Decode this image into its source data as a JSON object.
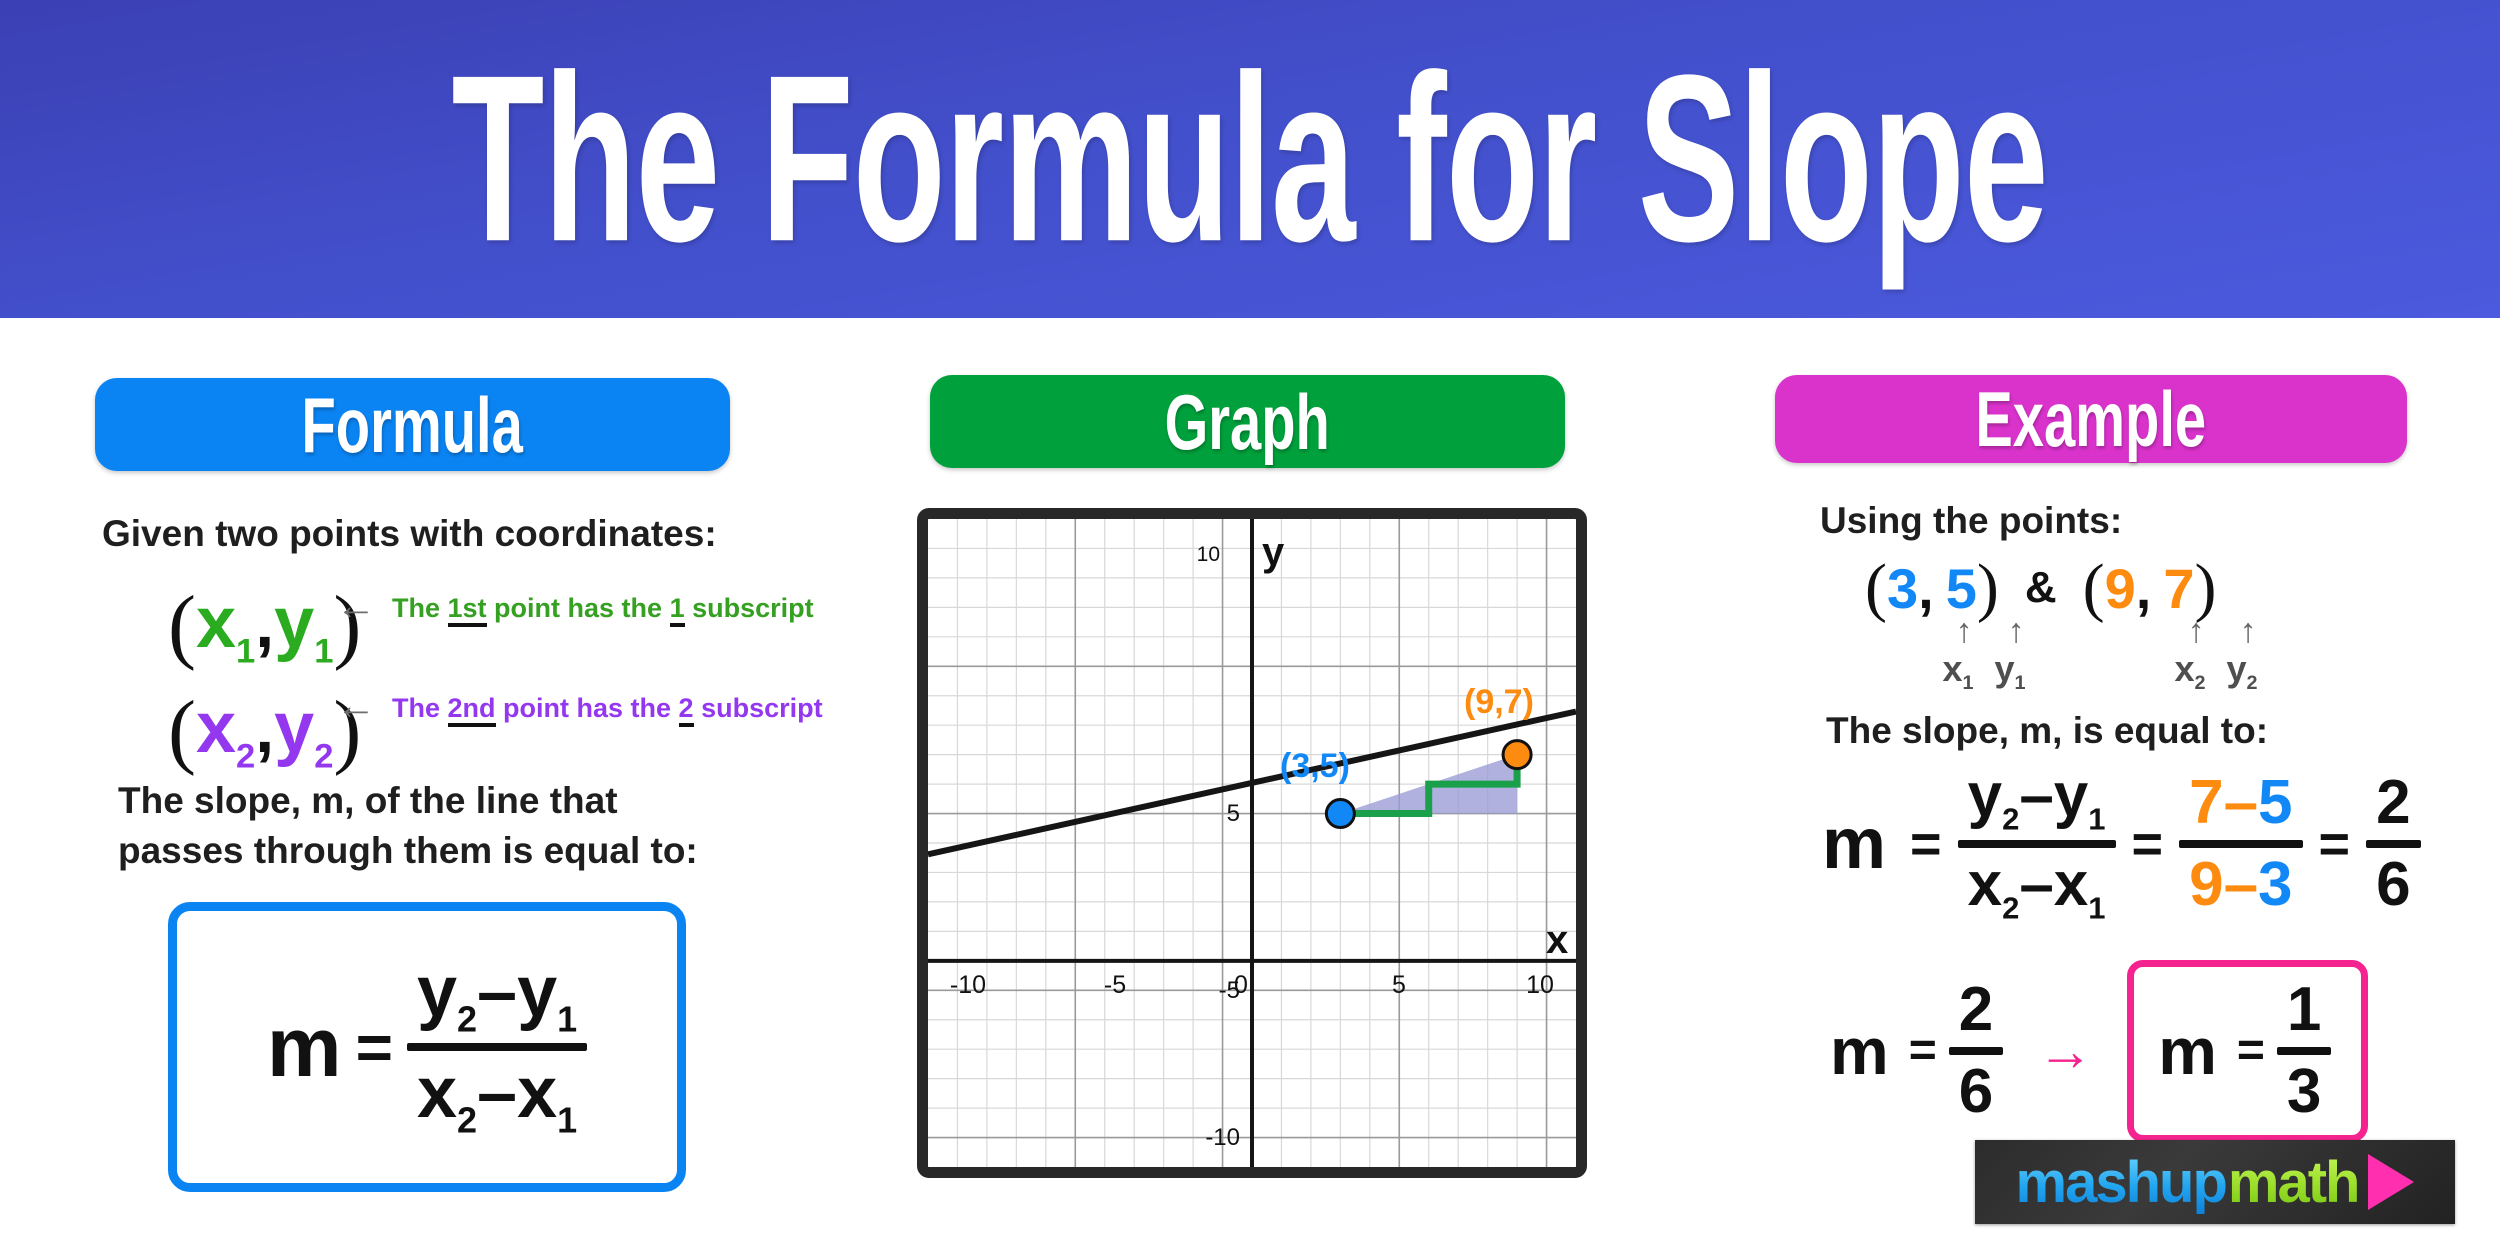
{
  "header": {
    "title": "The Formula for Slope",
    "bg_color": "#4350cc"
  },
  "sections": {
    "formula": {
      "label": "Formula",
      "color": "#0b84f3"
    },
    "graph": {
      "label": "Graph",
      "color": "#00a13c"
    },
    "example": {
      "label": "Example",
      "color": "#da33cc"
    }
  },
  "formula_panel": {
    "given_label": "Given two points with coordinates:",
    "point1": {
      "open": "(",
      "x": "x",
      "xsub": "1",
      "comma": ",",
      "y": "y",
      "ysub": "1",
      "close": ")",
      "color": "#2bab1f"
    },
    "point2": {
      "open": "(",
      "x": "x",
      "xsub": "2",
      "comma": ",",
      "y": "y",
      "ysub": "2",
      "close": ")",
      "color": "#9438f0"
    },
    "note1": {
      "arrow": "←",
      "pre": "The ",
      "u1": "1st",
      "mid": " point has the ",
      "u2": "1",
      "post": " subscript",
      "color": "#35a021"
    },
    "note2": {
      "arrow": "←",
      "pre": "The ",
      "u1": "2nd",
      "mid": " point has the ",
      "u2": "2",
      "post": " subscript",
      "color": "#9438f0"
    },
    "slope_desc_line1": "The slope, m, of the line that",
    "slope_desc_line2": "passes through them is equal to:",
    "boxed_formula": {
      "lhs": "m",
      "equals": "=",
      "numerator": {
        "a": "y",
        "asub": "2",
        "op": "–",
        "b": "y",
        "bsub": "1"
      },
      "denominator": {
        "a": "x",
        "asub": "2",
        "op": "–",
        "b": "x",
        "bsub": "1"
      },
      "border_color": "#0b84f3"
    }
  },
  "graph_panel": {
    "x_axis_label": "x",
    "y_axis_label": "y",
    "point_a_label": "(3,5)",
    "point_b_label": "(9,7)",
    "point_a_color": "#1288f7",
    "point_b_color": "#fd8b10",
    "step_color": "#1aa04a",
    "triangle_fill": "#9b9bd6",
    "frame_color": "#282828"
  },
  "example_panel": {
    "using_points_label": "Using the points:",
    "point1": {
      "open": "(",
      "x": "3",
      "comma": ",",
      "y": "5",
      "close": ")",
      "color": "#1288f7"
    },
    "point2": {
      "open": "(",
      "x": "9",
      "comma": ",",
      "y": "7",
      "close": ")",
      "color": "#fd8b10"
    },
    "ampersand": "&",
    "arrow_up": "↑",
    "labels1": {
      "x": "x",
      "xsub": "1",
      "y": "y",
      "ysub": "1"
    },
    "labels2": {
      "x": "x",
      "xsub": "2",
      "y": "y",
      "ysub": "2"
    },
    "slope_equal_label": "The slope, m, is equal to:",
    "main_equation": {
      "lhs": "m",
      "equals1": "=",
      "frac1": {
        "numerator": {
          "a": "y",
          "asub": "2",
          "op": "–",
          "b": "y",
          "bsub": "1"
        },
        "denominator": {
          "a": "x",
          "asub": "2",
          "op": "–",
          "b": "x",
          "bsub": "1"
        }
      },
      "equals2": "=",
      "frac2": {
        "num_a": "7",
        "num_op": "–",
        "num_b": "5",
        "den_a": "9",
        "den_op": "–",
        "den_b": "3"
      },
      "equals3": "=",
      "frac3": {
        "num": "2",
        "den": "6"
      }
    },
    "final_line": {
      "lhs": "m",
      "equals": "=",
      "frac": {
        "num": "2",
        "den": "6"
      },
      "arrow": "→",
      "answer": {
        "lhs": "m",
        "equals": "=",
        "num": "1",
        "den": "3"
      },
      "answer_border_color": "#f5238f",
      "arrow_color": "#f5238f"
    }
  },
  "logo": {
    "part1": "mashup",
    "part2": "math",
    "play_icon": "play-triangle",
    "part1_color": "#22a6f0",
    "part2_color": "#9ade2a",
    "play_color": "#ff2fb0"
  },
  "chart_data": {
    "type": "line",
    "title": "Graph",
    "xlabel": "x",
    "ylabel": "y",
    "xlim": [
      -11,
      11
    ],
    "ylim": [
      -11,
      11
    ],
    "xticks": [
      -10,
      -5,
      0,
      5,
      10
    ],
    "yticks": [
      -10,
      -5,
      5,
      10
    ],
    "grid": true,
    "grid_minor_step": 1,
    "grid_major_step": 5,
    "line": {
      "slope": 0.3333333,
      "intercept": 4,
      "equation": "y = (1/3)x + 4"
    },
    "points": [
      {
        "label": "(3,5)",
        "x": 3,
        "y": 5,
        "color": "#1288f7"
      },
      {
        "label": "(9,7)",
        "x": 9,
        "y": 7,
        "color": "#fd8b10"
      }
    ],
    "annotations": {
      "staircase": [
        [
          3,
          5
        ],
        [
          6,
          5
        ],
        [
          6,
          6
        ],
        [
          9,
          6
        ],
        [
          9,
          7
        ]
      ],
      "triangle": [
        [
          3,
          5
        ],
        [
          9,
          5
        ],
        [
          9,
          7
        ]
      ],
      "rise": 2,
      "run": 6,
      "slope_reduced": "1/3"
    }
  }
}
